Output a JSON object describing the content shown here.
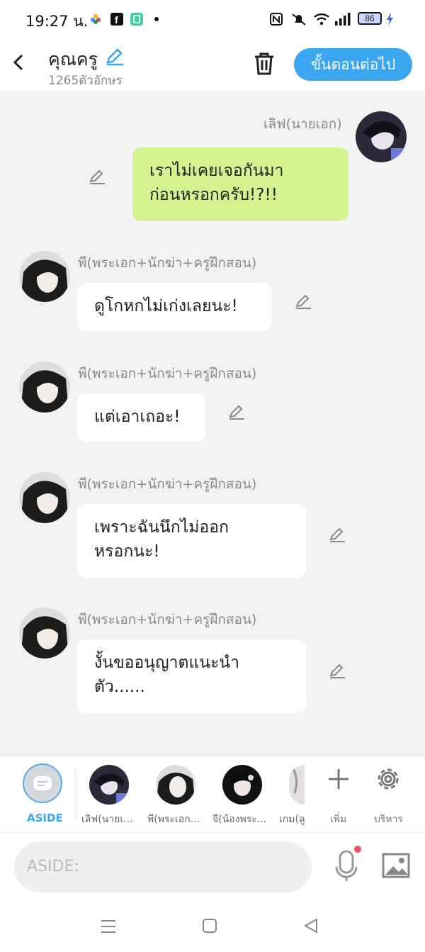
{
  "status_bar": {
    "time": "19:27 น.",
    "battery": "86"
  },
  "header": {
    "title": "คุณครู",
    "char_count": "1265ตัวอักษร",
    "next_label": "ขั้นตอนต่อไป"
  },
  "messages": [
    {
      "sender": "เลิฟ(นายเอก)",
      "lines": [
        "เราไม่เคยเจอกันมา",
        "ก่อนหรอกครับ!?!!"
      ],
      "side": "right",
      "color": "#d4f290"
    },
    {
      "sender": "พี(พระเอก+นักฆ่า+ครูฝึกสอน)",
      "lines": [
        "ดูโกหกไม่เก่งเลยนะ!"
      ],
      "side": "left",
      "color": "#ffffff"
    },
    {
      "sender": "พี(พระเอก+นักฆ่า+ครูฝึกสอน)",
      "lines": [
        "แต่เอาเถอะ!"
      ],
      "side": "left",
      "color": "#ffffff"
    },
    {
      "sender": "พี(พระเอก+นักฆ่า+ครูฝึกสอน)",
      "lines": [
        "เพราะฉันนึกไม่ออก",
        "หรอกนะ!"
      ],
      "side": "left",
      "color": "#ffffff"
    },
    {
      "sender": "พี(พระเอก+นักฆ่า+ครูฝึกสอน)",
      "lines": [
        "งั้นขออนุญาตแนะนำ",
        "ตัว......"
      ],
      "side": "left",
      "color": "#ffffff"
    }
  ],
  "character_bar": {
    "aside_label": "ASIDE",
    "characters": [
      "เลิฟ(นายเ...",
      "พี(พระเอก...",
      "จี(น้องพระ...",
      "เกม(ลู"
    ],
    "add_label": "เพิ่ม",
    "manage_label": "บริหาร"
  },
  "input": {
    "placeholder": "ASIDE:"
  },
  "icons": {
    "back": "chevron-left-icon",
    "edit": "pencil-icon",
    "trash": "trash-icon",
    "plus": "plus-icon",
    "gear": "gear-icon",
    "mic": "microphone-icon",
    "image": "image-icon"
  },
  "colors": {
    "accent": "#3aa6f2",
    "own_bubble": "#d4f290",
    "background": "#f2f2f2"
  }
}
